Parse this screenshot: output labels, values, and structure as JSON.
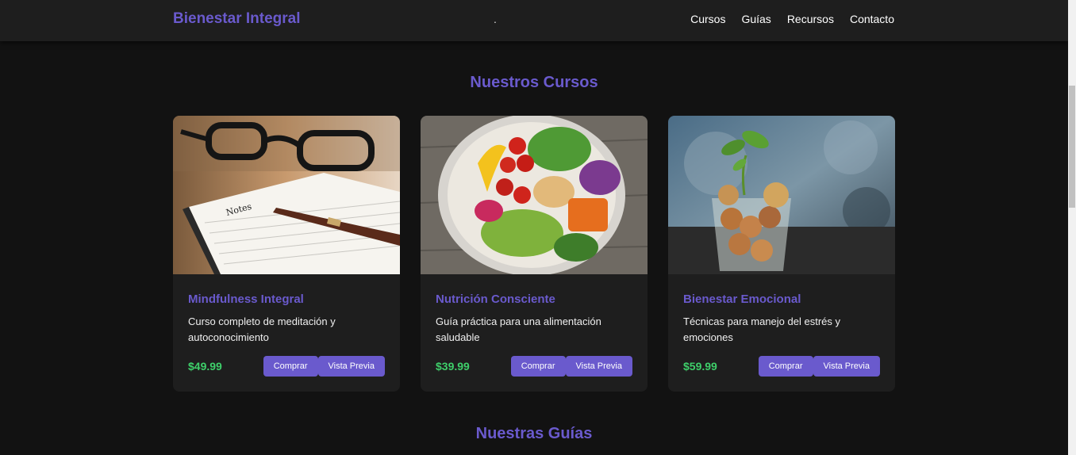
{
  "nav": {
    "brand": "Bienestar Integral",
    "dot": ".",
    "links": [
      "Cursos",
      "Guías",
      "Recursos",
      "Contacto"
    ]
  },
  "sections": {
    "courses_title": "Nuestros Cursos",
    "guides_title": "Nuestras Guías"
  },
  "courses": [
    {
      "title": "Mindfulness Integral",
      "description": "Curso completo de meditación y autoconocimiento",
      "price": "$49.99",
      "buy_label": "Comprar",
      "preview_label": "Vista Previa",
      "image": "notebook-glasses-pen"
    },
    {
      "title": "Nutrición Consciente",
      "description": "Guía práctica para una alimentación saludable",
      "price": "$39.99",
      "buy_label": "Comprar",
      "preview_label": "Vista Previa",
      "image": "salad-bowl"
    },
    {
      "title": "Bienestar Emocional",
      "description": "Técnicas para manejo del estrés y emociones",
      "price": "$59.99",
      "buy_label": "Comprar",
      "preview_label": "Vista Previa",
      "image": "plant-in-coin-jar"
    }
  ],
  "colors": {
    "accent": "#6a5acd",
    "price": "#3ecf6a",
    "background": "#121212",
    "card": "#1e1e1e"
  }
}
